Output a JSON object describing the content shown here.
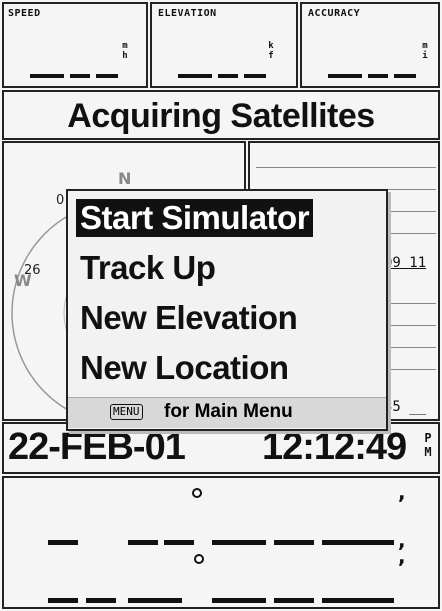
{
  "fields": [
    {
      "label": "SPEED",
      "unit_top": "m",
      "unit_bottom": "h"
    },
    {
      "label": "ELEVATION",
      "unit_top": "k",
      "unit_bottom": "f"
    },
    {
      "label": "ACCURACY",
      "unit_top": "m",
      "unit_bottom": "i"
    }
  ],
  "status": "Acquiring Satellites",
  "compass": {
    "north": "N",
    "west": "W",
    "ring_left_top": "0",
    "ring_left_mid": "26"
  },
  "satellite_labels": {
    "row1": "09 11",
    "row2": "35 __"
  },
  "menu": {
    "items": [
      "Start Simulator",
      "Track Up",
      "New Elevation",
      "New Location"
    ],
    "selected_index": 0,
    "footer_key": "MENU",
    "footer_text": "for Main Menu"
  },
  "datetime": {
    "date": "22-FEB-01",
    "time": "12:12:49",
    "ampm_top": "P",
    "ampm_bottom": "M"
  },
  "colors": {
    "screen": "#f5f5f5",
    "ink": "#111111",
    "highlight": "#111111"
  }
}
